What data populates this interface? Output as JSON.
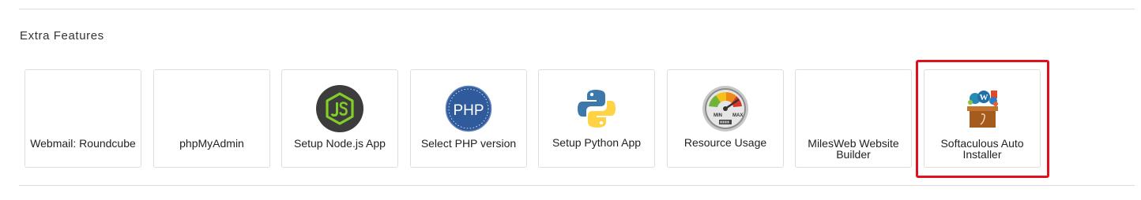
{
  "section": {
    "title": "Extra Features"
  },
  "tiles": [
    {
      "label": "Webmail: Roundcube",
      "icon": "roundcube-icon"
    },
    {
      "label": "phpMyAdmin",
      "icon": "phpmyadmin-icon"
    },
    {
      "label": "Setup Node.js App",
      "icon": "nodejs-icon"
    },
    {
      "label": "Select PHP version",
      "icon": "php-icon"
    },
    {
      "label": "Setup Python App",
      "icon": "python-icon"
    },
    {
      "label": "Resource Usage",
      "icon": "gauge-icon"
    },
    {
      "label": "MilesWeb Website Builder",
      "icon": "website-builder-icon"
    },
    {
      "label": "Softaculous Auto Installer",
      "icon": "softaculous-icon"
    }
  ],
  "icon_text": {
    "php": "PHP",
    "gauge_min": "MIN",
    "gauge_max": "MAX"
  },
  "colors": {
    "highlight": "#e0101e",
    "nodejs_bg": "#3c3c3c",
    "nodejs_green": "#83cd29",
    "php_blue": "#2f5a9b",
    "python_blue": "#3c78aa",
    "python_yellow": "#ffd343"
  }
}
